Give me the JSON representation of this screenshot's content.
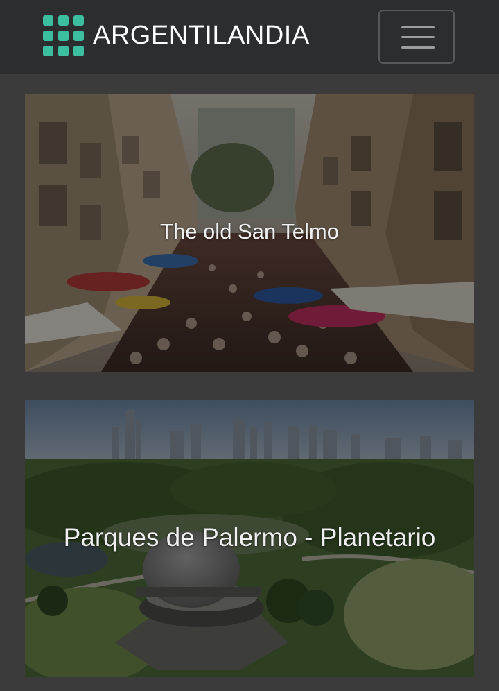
{
  "navbar": {
    "brand_name": "ARGENTILANDIA",
    "logo_color": "#3bbfa0",
    "toggle_icon": "hamburger-icon",
    "background": "#2c2d2f"
  },
  "cards": [
    {
      "title": "The old San Telmo",
      "image": "street-market-photo"
    },
    {
      "title": "Parques de Palermo - Planetario",
      "image": "planetarium-park-photo"
    }
  ],
  "page_background": "#3b3b3b"
}
